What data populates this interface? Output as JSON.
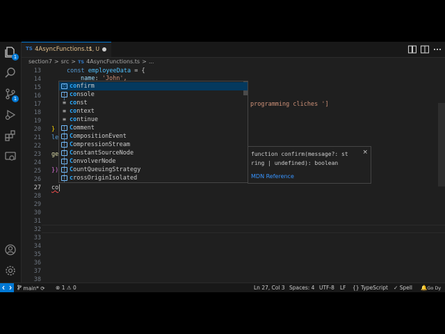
{
  "tab": {
    "lang": "TS",
    "filename": "4AsyncFunctions.ts",
    "status": "1, U"
  },
  "breadcrumb": {
    "folder1": "section7",
    "sep": ">",
    "folder2": "src",
    "lang": "TS",
    "file": "4AsyncFunctions.ts",
    "more": "..."
  },
  "activity": {
    "explorer_badge": "1",
    "scm_badge": "1"
  },
  "lines": {
    "l13": "13",
    "l14": "14",
    "l15": "15",
    "l16": "16",
    "l17": "17",
    "l18": "18",
    "l19": "19",
    "l20": "20",
    "l21": "21",
    "l22": "22",
    "l23": "23",
    "l24": "24",
    "l25": "25",
    "l26": "26",
    "l27": "27",
    "l28": "28",
    "l29": "29",
    "l30": "30",
    "l31": "31",
    "l32": "32",
    "l33": "33",
    "l34": "34",
    "l35": "35",
    "l36": "36",
    "l37": "37",
    "l38": "38"
  },
  "code": {
    "c13_kw": "const",
    "c13_name": "employeeData",
    "c13_rest": " = {",
    "c14_key": "name",
    "c14_colon": ": ",
    "c14_val": "'John',",
    "c17": "programming cliches ']",
    "c19": "}",
    "c21": "le",
    "c22": "ge",
    "c24": "})",
    "c27": "co"
  },
  "suggestions": [
    {
      "match": "co",
      "rest": "nfirm",
      "icon": "method"
    },
    {
      "match": "co",
      "rest": "nsole",
      "icon": "var"
    },
    {
      "match": "co",
      "rest": "nst",
      "icon": "keyword"
    },
    {
      "match": "co",
      "rest": "ntext",
      "icon": "keyword"
    },
    {
      "match": "co",
      "rest": "ntinue",
      "icon": "keyword"
    },
    {
      "match": "C",
      "rest": "omment",
      "icon": "var"
    },
    {
      "match": "C",
      "rest": "ompositionEvent",
      "icon": "var"
    },
    {
      "match": "C",
      "rest": "ompressionStream",
      "icon": "var"
    },
    {
      "match": "C",
      "rest": "onstantSourceNode",
      "icon": "var"
    },
    {
      "match": "C",
      "rest": "onvolverNode",
      "icon": "var"
    },
    {
      "match": "C",
      "rest": "ountQueuingStrategy",
      "icon": "var"
    },
    {
      "match": "c",
      "rest": "rossOriginIsolated",
      "icon": "var"
    }
  ],
  "details": {
    "line1": "function confirm(message?: st",
    "line2": "ring | undefined): boolean",
    "link": "MDN Reference",
    "close": "×"
  },
  "statusbar": {
    "branch": "main*",
    "errors": "1",
    "warnings": "0",
    "position": "Ln 27, Col 3",
    "spaces": "Spaces: 4",
    "encoding": "UTF-8",
    "eol": "LF",
    "braces": "{}",
    "language": "TypeScript",
    "spell": "Spell",
    "godaddy": "Go Dy"
  },
  "colors": {
    "accent": "#0078d4",
    "keyword": "#569cd6",
    "variable": "#4fc1ff",
    "string": "#ce9178",
    "match": "#2aaaff",
    "link": "#3794ff"
  }
}
